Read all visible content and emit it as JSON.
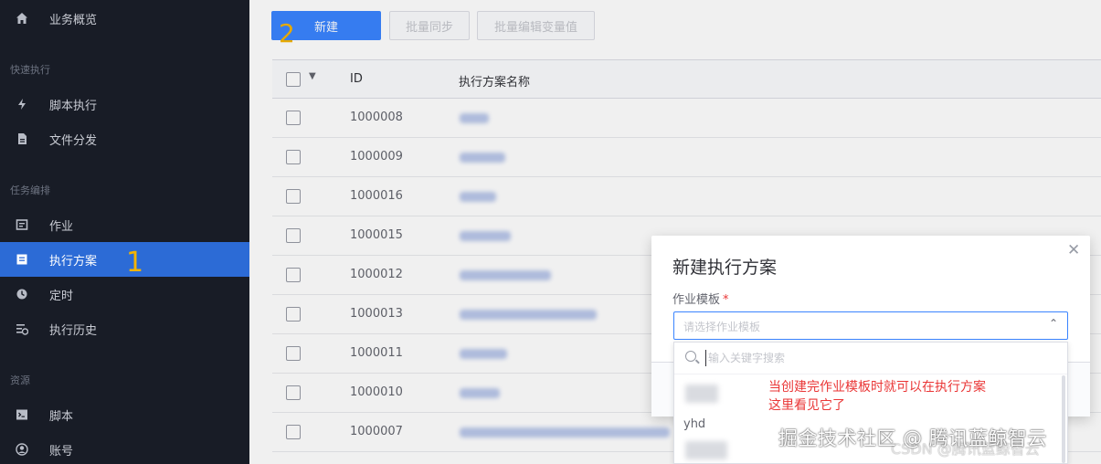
{
  "sidebar": {
    "items": [
      {
        "label": "业务概览",
        "icon": "home-icon"
      },
      {
        "label": "脚本执行",
        "icon": "bolt-icon"
      },
      {
        "label": "文件分发",
        "icon": "file-icon"
      },
      {
        "label": "作业",
        "icon": "job-icon"
      },
      {
        "label": "执行方案",
        "icon": "plan-icon"
      },
      {
        "label": "定时",
        "icon": "clock-icon"
      },
      {
        "label": "执行历史",
        "icon": "history-icon"
      },
      {
        "label": "脚本",
        "icon": "terminal-icon"
      },
      {
        "label": "账号",
        "icon": "account-icon"
      }
    ],
    "groups": [
      "快速执行",
      "任务编排",
      "资源"
    ],
    "active_index": 4,
    "marker": "1"
  },
  "toolbar": {
    "new_label": "新建",
    "batch_sync_label": "批量同步",
    "batch_edit_label": "批量编辑变量值",
    "marker": "2"
  },
  "table": {
    "headers": {
      "id": "ID",
      "name": "执行方案名称"
    },
    "rows": [
      {
        "id": "1000008"
      },
      {
        "id": "1000009"
      },
      {
        "id": "1000016"
      },
      {
        "id": "1000015"
      },
      {
        "id": "1000012"
      },
      {
        "id": "1000013"
      },
      {
        "id": "1000011"
      },
      {
        "id": "1000010"
      },
      {
        "id": "1000007"
      }
    ]
  },
  "dialog": {
    "title": "新建执行方案",
    "field_label": "作业模板",
    "required_mark": "*",
    "select_placeholder": "请选择作业模板",
    "search_placeholder": "输入关键字搜索",
    "visible_option": "yhd"
  },
  "annotation": {
    "line1": "当创建完作业模板时就可以在执行方案",
    "line2": "这里看见它了"
  },
  "watermark": {
    "text": "掘金技术社区 @ 腾讯蓝鲸智云",
    "csdn": "CSDN @腾讯蓝鲸智云"
  },
  "colors": {
    "sidebar_bg": "#181c26",
    "active_bg": "#2c6bd6",
    "primary": "#3a84ff",
    "marker": "#f5b400",
    "annotation": "#ea3636"
  }
}
